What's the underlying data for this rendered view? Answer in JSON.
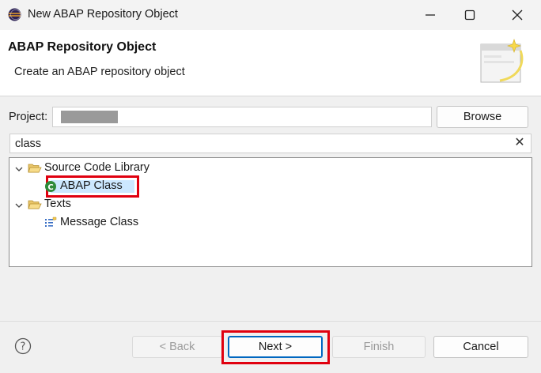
{
  "window": {
    "title": "New ABAP Repository Object",
    "controls": {
      "minimize_icon": "minimize-icon",
      "maximize_icon": "maximize-icon",
      "close_icon": "close-icon"
    }
  },
  "header": {
    "title": "ABAP Repository Object",
    "description": "Create an ABAP repository object"
  },
  "form": {
    "project_label": "Project:",
    "project_value": "",
    "browse_label": "Browse",
    "filter_value": "class",
    "filter_clear_icon": "clear-icon"
  },
  "tree": {
    "nodes": [
      {
        "label": "Source Code Library",
        "expanded": true,
        "children": [
          {
            "label": "ABAP Class",
            "selected": true,
            "icon": "abap-class-icon"
          }
        ]
      },
      {
        "label": "Texts",
        "expanded": true,
        "children": [
          {
            "label": "Message Class",
            "selected": false,
            "icon": "message-class-icon"
          }
        ]
      }
    ]
  },
  "footer": {
    "back_label": "< Back",
    "next_label": "Next >",
    "finish_label": "Finish",
    "cancel_label": "Cancel"
  },
  "colors": {
    "highlight_frame": "#e0000f",
    "selection_bg": "#cce8ff",
    "default_button_border": "#0067c0"
  }
}
